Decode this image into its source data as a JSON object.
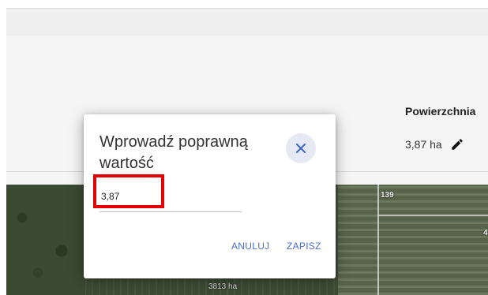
{
  "panel": {
    "label": "Powierzchnia",
    "value": "3,87 ha",
    "edit_icon": "pencil-icon"
  },
  "map": {
    "parcel_number": "139",
    "area_label": "3813 ha",
    "side_label": "4"
  },
  "dialog": {
    "title": "Wprowadź poprawną wartość",
    "close_icon": "close-icon",
    "input_value": "3,87",
    "cancel_label": "ANULUJ",
    "save_label": "ZAPISZ",
    "accent_color": "#4a6ec6",
    "highlight_color": "#e30000"
  }
}
